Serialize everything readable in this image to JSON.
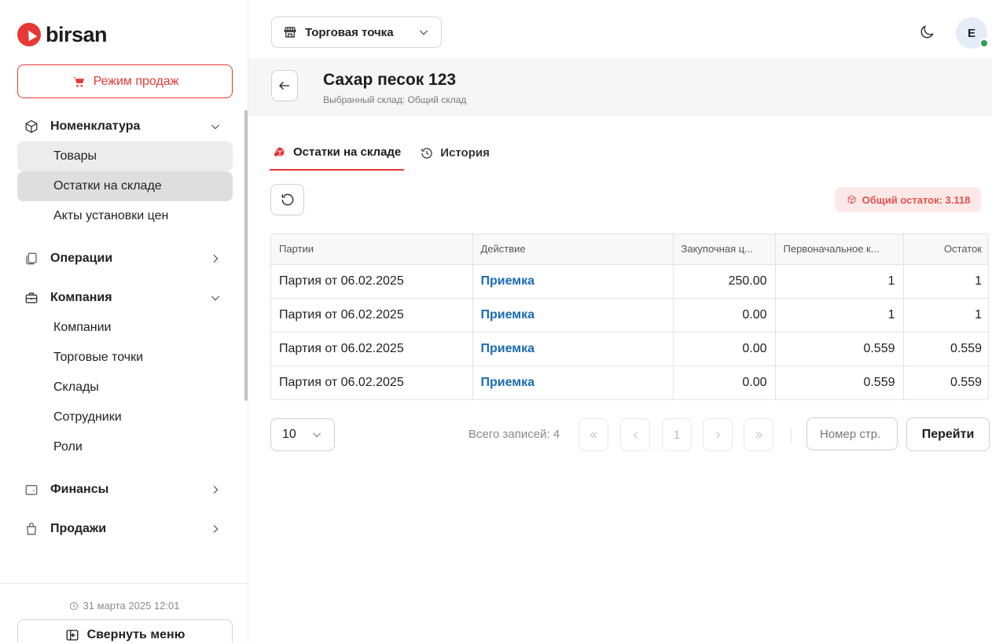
{
  "app": {
    "brand": "birsan"
  },
  "sidebar": {
    "sales_mode_label": "Режим продаж",
    "groups": [
      {
        "label": "Номенклатура",
        "icon": "box-icon",
        "expanded": true,
        "items": [
          {
            "label": "Товары"
          },
          {
            "label": "Остатки на складе"
          },
          {
            "label": "Акты установки цен"
          }
        ]
      },
      {
        "label": "Операции",
        "icon": "operations-icon",
        "expanded": false
      },
      {
        "label": "Компания",
        "icon": "briefcase-icon",
        "expanded": true,
        "items": [
          {
            "label": "Компании"
          },
          {
            "label": "Торговые точки"
          },
          {
            "label": "Склады"
          },
          {
            "label": "Сотрудники"
          },
          {
            "label": "Роли"
          }
        ]
      },
      {
        "label": "Финансы",
        "icon": "wallet-icon",
        "expanded": false
      },
      {
        "label": "Продажи",
        "icon": "bag-icon",
        "expanded": false
      }
    ],
    "datetime": "31 марта 2025 12:01",
    "collapse_label": "Свернуть меню"
  },
  "topbar": {
    "store_select_label": "Торговая точка",
    "avatar_initial": "E"
  },
  "header": {
    "title": "Сахар песок 123",
    "subtitle": "Выбранный склад: Общий склад"
  },
  "tabs": [
    {
      "label": "Остатки на складе",
      "active": true
    },
    {
      "label": "История",
      "active": false
    }
  ],
  "total_badge": "Общий остаток: 3.118",
  "table": {
    "columns": [
      "Партии",
      "Действие",
      "Закупочная ц...",
      "Первоначальное к...",
      "Остаток"
    ],
    "rows": [
      {
        "batch": "Партия от 06.02.2025",
        "action": "Приемка",
        "price": "250.00",
        "initial": "1",
        "remain": "1"
      },
      {
        "batch": "Партия от 06.02.2025",
        "action": "Приемка",
        "price": "0.00",
        "initial": "1",
        "remain": "1"
      },
      {
        "batch": "Партия от 06.02.2025",
        "action": "Приемка",
        "price": "0.00",
        "initial": "0.559",
        "remain": "0.559"
      },
      {
        "batch": "Партия от 06.02.2025",
        "action": "Приемка",
        "price": "0.00",
        "initial": "0.559",
        "remain": "0.559"
      }
    ]
  },
  "pagination": {
    "page_size": "10",
    "total_records": "Всего записей: 4",
    "current_page": "1",
    "page_input_placeholder": "Номер стр.",
    "go_label": "Перейти"
  },
  "colors": {
    "accent": "#e53935",
    "link": "#1a6bb5",
    "badge_bg": "#fde8e8",
    "online": "#2e9e50"
  }
}
